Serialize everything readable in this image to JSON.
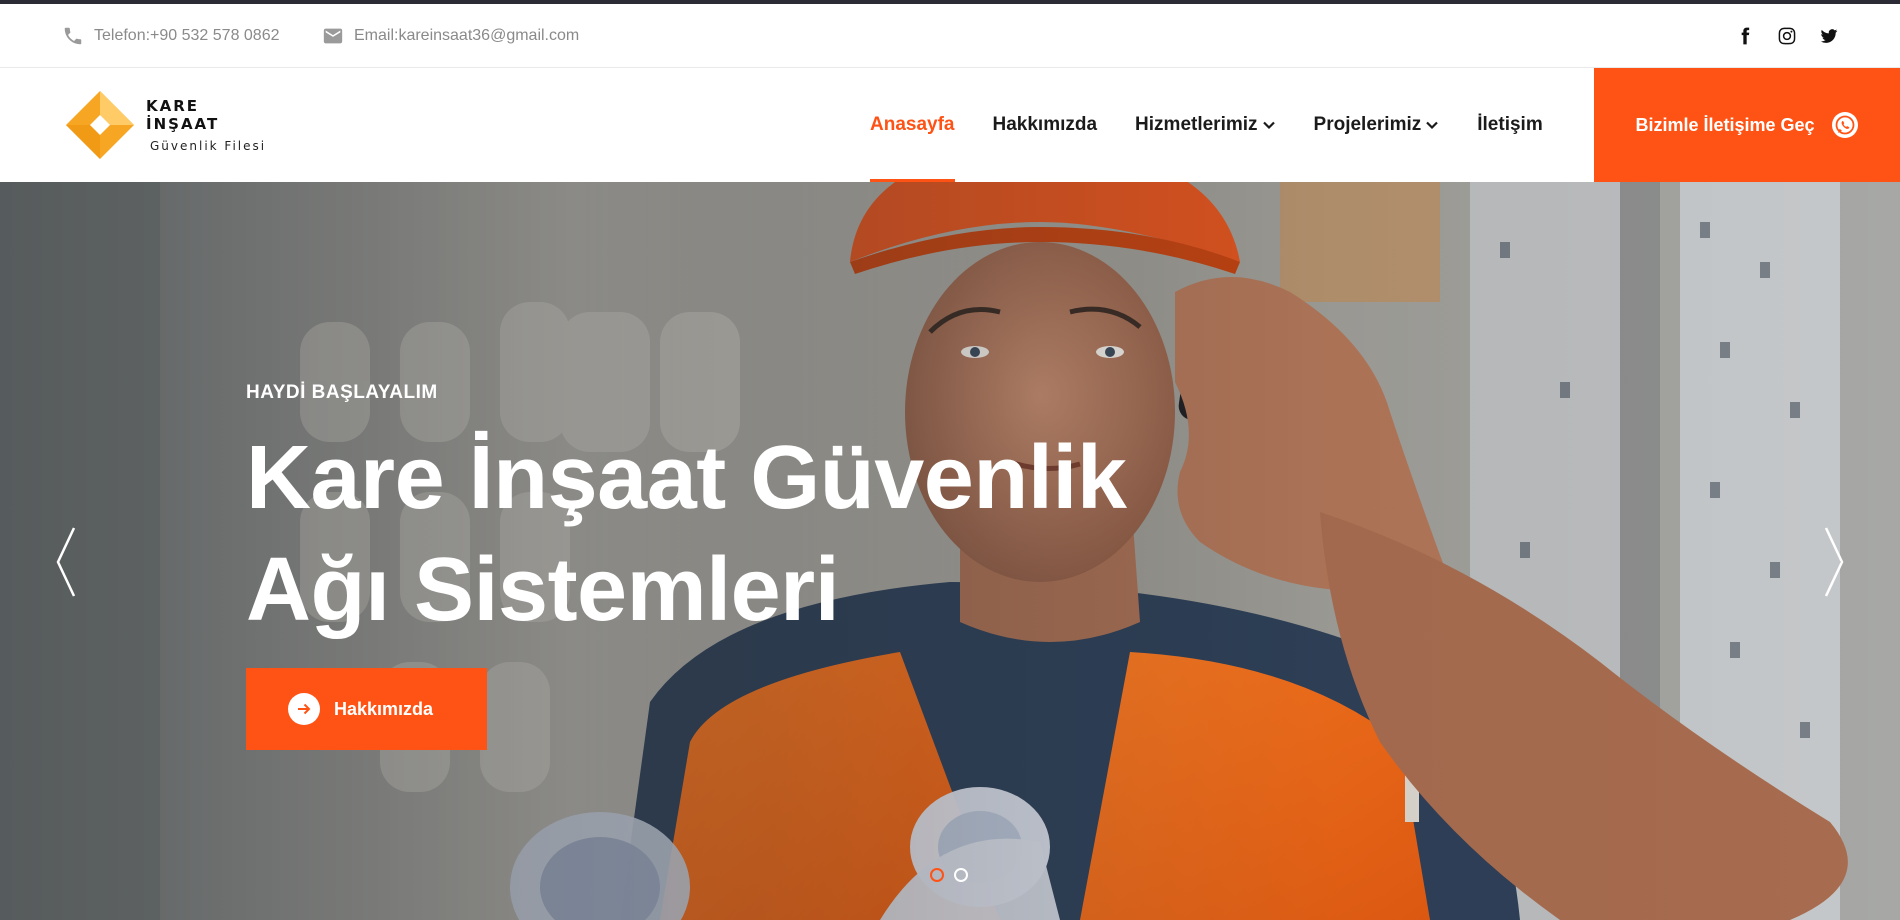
{
  "topbar": {
    "phone_text": "Telefon:+90 532 578 0862",
    "email_text": "Email:kareinsaat36@gmail.com",
    "socials": [
      "facebook-icon",
      "instagram-icon",
      "twitter-icon"
    ]
  },
  "brand": {
    "title": "KARE İNŞAAT",
    "subtitle": "Güvenlik Filesi",
    "accent": "#ff5316",
    "logo_colors": [
      "#f7a623",
      "#ffcb66"
    ]
  },
  "nav": {
    "items": [
      {
        "label": "Anasayfa",
        "active": true,
        "dropdown": false
      },
      {
        "label": "Hakkımızda",
        "active": false,
        "dropdown": false
      },
      {
        "label": "Hizmetlerimiz",
        "active": false,
        "dropdown": true
      },
      {
        "label": "Projelerimiz",
        "active": false,
        "dropdown": true
      },
      {
        "label": "İletişim",
        "active": false,
        "dropdown": false
      }
    ],
    "cta_label": "Bizimle İletişime Geç",
    "cta_icon": "whatsapp-icon"
  },
  "hero": {
    "eyebrow": "HAYDİ BAŞLAYALIM",
    "headline_line1": "Kare İnşaat Güvenlik",
    "headline_line2": "Ağı Sistemleri",
    "button_label": "Hakkımızda",
    "button_icon": "arrow-right-icon",
    "slides_total": 2,
    "active_slide": 1
  }
}
